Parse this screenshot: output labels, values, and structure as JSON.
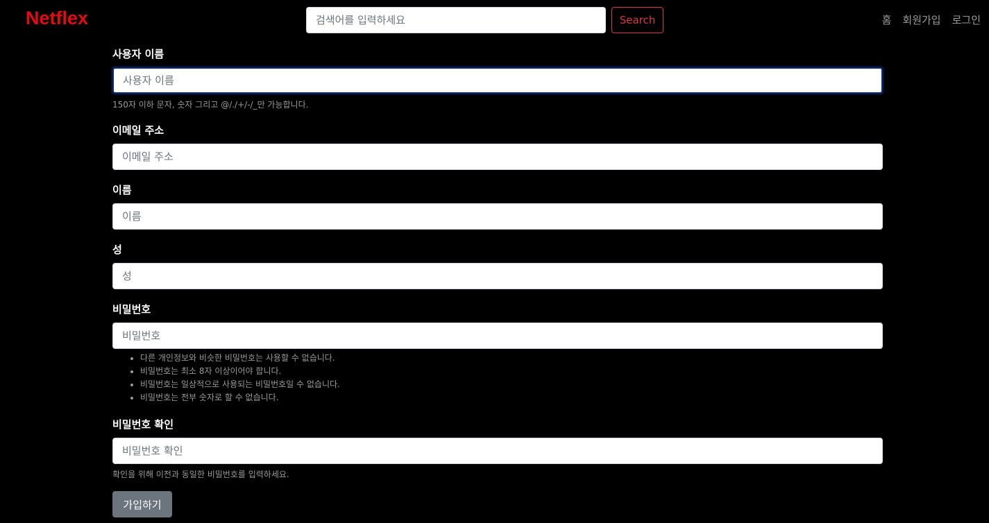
{
  "navbar": {
    "brand": "Netflex",
    "search_placeholder": "검색어를 입력하세요",
    "search_button": "Search",
    "links": [
      "홈",
      "회원가입",
      "로그인"
    ]
  },
  "form": {
    "username": {
      "label": "사용자 이름",
      "placeholder": "사용자 이름",
      "help": "150자 이하 문자, 숫자 그리고 @/./+/-/_만 가능합니다."
    },
    "email": {
      "label": "이메일 주소",
      "placeholder": "이메일 주소"
    },
    "first_name": {
      "label": "이름",
      "placeholder": "이름"
    },
    "last_name": {
      "label": "성",
      "placeholder": "성"
    },
    "password": {
      "label": "비밀번호",
      "placeholder": "비밀번호",
      "help_items": [
        "다른 개인정보와 비슷한 비밀번호는 사용할 수 없습니다.",
        "비밀번호는 최소 8자 이상이어야 합니다.",
        "비밀번호는 일상적으로 사용되는 비밀번호일 수 없습니다.",
        "비밀번호는 전부 숫자로 할 수 없습니다."
      ]
    },
    "password_confirm": {
      "label": "비밀번호 확인",
      "placeholder": "비밀번호 확인",
      "help": "확인을 위해 이전과 동일한 비밀번호를 입력하세요."
    },
    "submit_label": "가입하기"
  },
  "colors": {
    "brand": "#e50914",
    "search_button": "#dc3545",
    "submit_button": "#6c757d"
  }
}
